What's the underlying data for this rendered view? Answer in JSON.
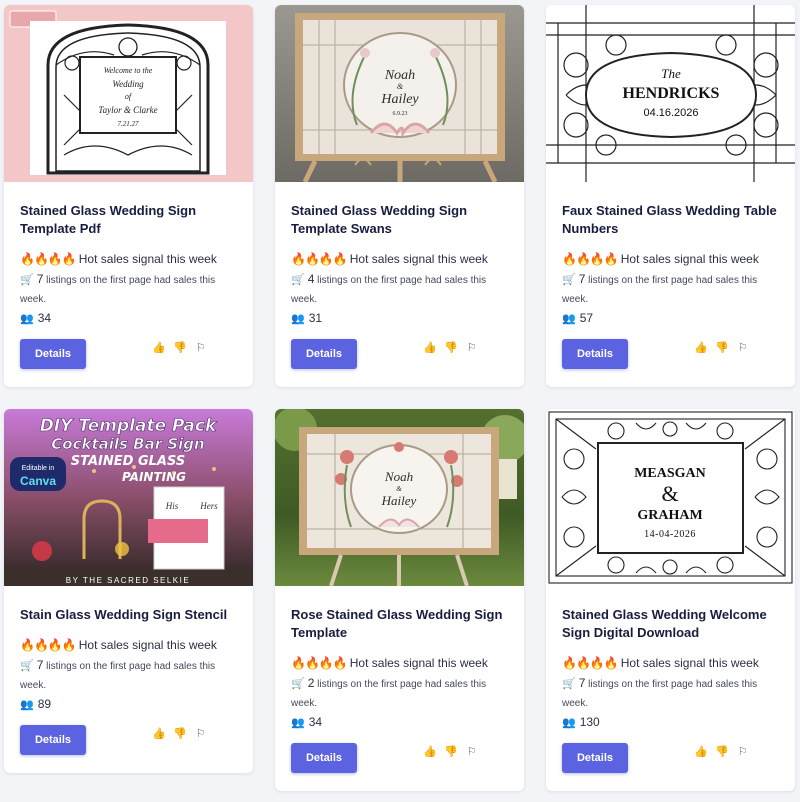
{
  "cards": [
    {
      "title": "Stained Glass Wedding Sign Template Pdf",
      "hot_icons": "🔥🔥🔥🔥",
      "hot_text": "Hot sales signal this week",
      "listing_count": "7",
      "listing_text": "listings on the first page had sales this week.",
      "people_count": "34",
      "button_label": "Details",
      "image_text": [
        "Welcome to the",
        "Wedding",
        "of",
        "Taylor & Clarke",
        "7.21.27"
      ]
    },
    {
      "title": "Stained Glass Wedding Sign Template Swans",
      "hot_icons": "🔥🔥🔥🔥",
      "hot_text": "Hot sales signal this week",
      "listing_count": "4",
      "listing_text": "listings on the first page had sales this week.",
      "people_count": "31",
      "button_label": "Details",
      "image_text": [
        "Noah",
        "&",
        "Hailey",
        "6.9.23"
      ]
    },
    {
      "title": "Faux Stained Glass Wedding Table Numbers",
      "hot_icons": "🔥🔥🔥🔥",
      "hot_text": "Hot sales signal this week",
      "listing_count": "7",
      "listing_text": "listings on the first page had sales this week.",
      "people_count": "57",
      "button_label": "Details",
      "image_text": [
        "The",
        "HENDRICKS",
        "04.16.2026"
      ]
    },
    {
      "title": "Stain Glass Wedding Sign Stencil",
      "hot_icons": "🔥🔥🔥🔥",
      "hot_text": "Hot sales signal this week",
      "listing_count": "7",
      "listing_text": "listings on the first page had sales this week.",
      "people_count": "89",
      "button_label": "Details",
      "image_text": [
        "DIY Template Pack",
        "Cocktails Bar Sign",
        "STAINED GLASS",
        "PAINTING",
        "Editable in",
        "Canva",
        "BY THE SACRED SELKIE",
        "His",
        "Hers"
      ]
    },
    {
      "title": "Rose Stained Glass Wedding Sign Template",
      "hot_icons": "🔥🔥🔥🔥",
      "hot_text": "Hot sales signal this week",
      "listing_count": "2",
      "listing_text": "listings on the first page had sales this week.",
      "people_count": "34",
      "button_label": "Details",
      "image_text": [
        "Noah",
        "&",
        "Hailey"
      ]
    },
    {
      "title": "Stained Glass Wedding Welcome Sign Digital Download",
      "hot_icons": "🔥🔥🔥🔥",
      "hot_text": "Hot sales signal this week",
      "listing_count": "7",
      "listing_text": "listings on the first page had sales this week.",
      "people_count": "130",
      "button_label": "Details",
      "image_text": [
        "MEASGAN",
        "&",
        "GRAHAM",
        "14-04-2026"
      ]
    }
  ],
  "icons": {
    "cart": "🛒",
    "people": "👥",
    "like": "👍",
    "dislike": "👎",
    "flag": "⚐"
  },
  "colors": {
    "button": "#5b63e0",
    "title": "#181d3f",
    "page_bg": "#f3f4f8",
    "thumb1_bg": "#f3c6c8"
  }
}
